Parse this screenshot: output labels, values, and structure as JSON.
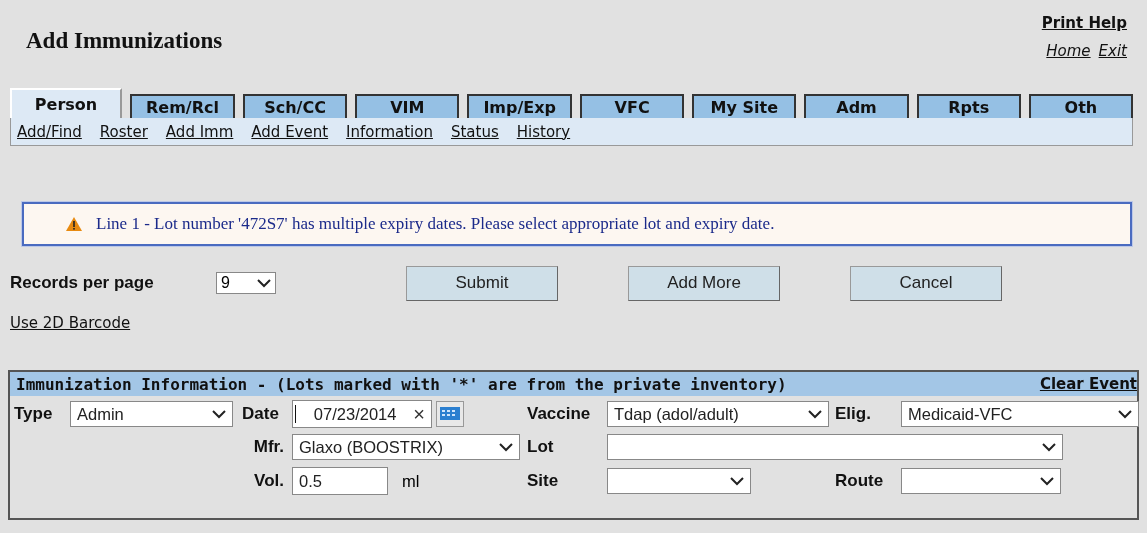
{
  "header": {
    "title": "Add Immunizations",
    "links": [
      {
        "label": "Print Help",
        "kind": "bold"
      },
      {
        "label": "Home",
        "kind": "italic"
      },
      {
        "label": "Exit",
        "kind": "italic"
      }
    ]
  },
  "tabs": [
    {
      "label": "Person",
      "selected": true
    },
    {
      "label": "Rem/Rcl",
      "selected": false
    },
    {
      "label": "Sch/CC",
      "selected": false
    },
    {
      "label": "VIM",
      "selected": false
    },
    {
      "label": "Imp/Exp",
      "selected": false
    },
    {
      "label": "VFC",
      "selected": false
    },
    {
      "label": "My Site",
      "selected": false
    },
    {
      "label": "Adm",
      "selected": false
    },
    {
      "label": "Rpts",
      "selected": false
    },
    {
      "label": "Oth",
      "selected": false
    }
  ],
  "subnav": [
    "Add/Find",
    "Roster",
    "Add Imm",
    "Add Event",
    "Information",
    "Status",
    "History"
  ],
  "alert": {
    "message": "Line 1 - Lot number '472S7' has multiple expiry dates. Please select appropriate lot and expiry date."
  },
  "records_per_page": {
    "label": "Records per page",
    "value": "9"
  },
  "buttons": [
    "Submit",
    "Add More",
    "Cancel"
  ],
  "barcode_link": "Use 2D Barcode",
  "panel": {
    "title": "Immunization Information - (Lots marked with '*' are from the private inventory)",
    "clear_link": "Clear Event",
    "fields": [
      {
        "label": "Type",
        "kind": "select",
        "value": "Admin"
      },
      {
        "label": "Date",
        "kind": "date",
        "value": "07/23/2014",
        "clear": "×"
      },
      {
        "label": "Vaccine",
        "kind": "select",
        "value": "Tdap (adol/adult)"
      },
      {
        "label": "Elig.",
        "kind": "select",
        "value": "Medicaid-VFC"
      },
      {
        "label": "Mfr.",
        "kind": "select",
        "value": "Glaxo (BOOSTRIX)"
      },
      {
        "label": "Lot",
        "kind": "select"
      },
      {
        "label": "Vol.",
        "kind": "input",
        "value": "0.5",
        "unit": "ml"
      },
      {
        "label": "Site",
        "kind": "select"
      },
      {
        "label": "Route",
        "kind": "select"
      }
    ]
  }
}
